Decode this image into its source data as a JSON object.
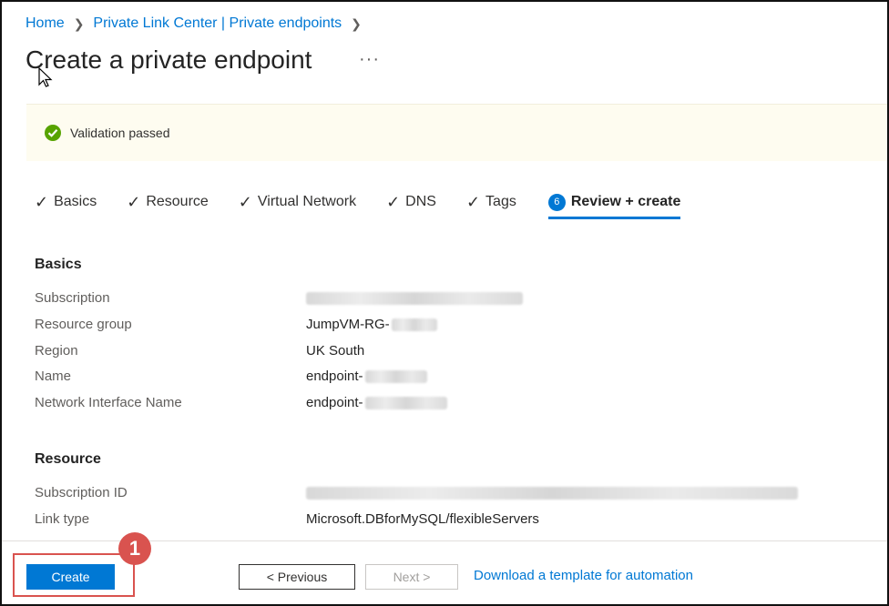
{
  "breadcrumb": {
    "items": [
      "Home",
      "Private Link Center | Private endpoints"
    ]
  },
  "page": {
    "title": "Create a private endpoint",
    "more": "···"
  },
  "banner": {
    "text": "Validation passed",
    "status_color": "#57a300"
  },
  "tabs": [
    {
      "label": "Basics"
    },
    {
      "label": "Resource"
    },
    {
      "label": "Virtual Network"
    },
    {
      "label": "DNS"
    },
    {
      "label": "Tags"
    },
    {
      "label": "Review + create",
      "step": "6",
      "active": true
    }
  ],
  "basics": {
    "title": "Basics",
    "rows": [
      {
        "label": "Subscription",
        "value": ""
      },
      {
        "label": "Resource group",
        "value": "JumpVM-RG-"
      },
      {
        "label": "Region",
        "value": "UK South"
      },
      {
        "label": "Name",
        "value": "endpoint-"
      },
      {
        "label": "Network Interface Name",
        "value": "endpoint-"
      }
    ]
  },
  "resource": {
    "title": "Resource",
    "rows": [
      {
        "label": "Subscription ID",
        "value": ""
      },
      {
        "label": "Link type",
        "value": "Microsoft.DBforMySQL/flexibleServers"
      }
    ]
  },
  "footer": {
    "create_label": "Create",
    "previous_label": "< Previous",
    "next_label": "Next >",
    "download_link": "Download a template for automation"
  },
  "annotation": {
    "step_number": "1",
    "color": "#d9534f"
  },
  "colors": {
    "accent": "#0078d4"
  }
}
